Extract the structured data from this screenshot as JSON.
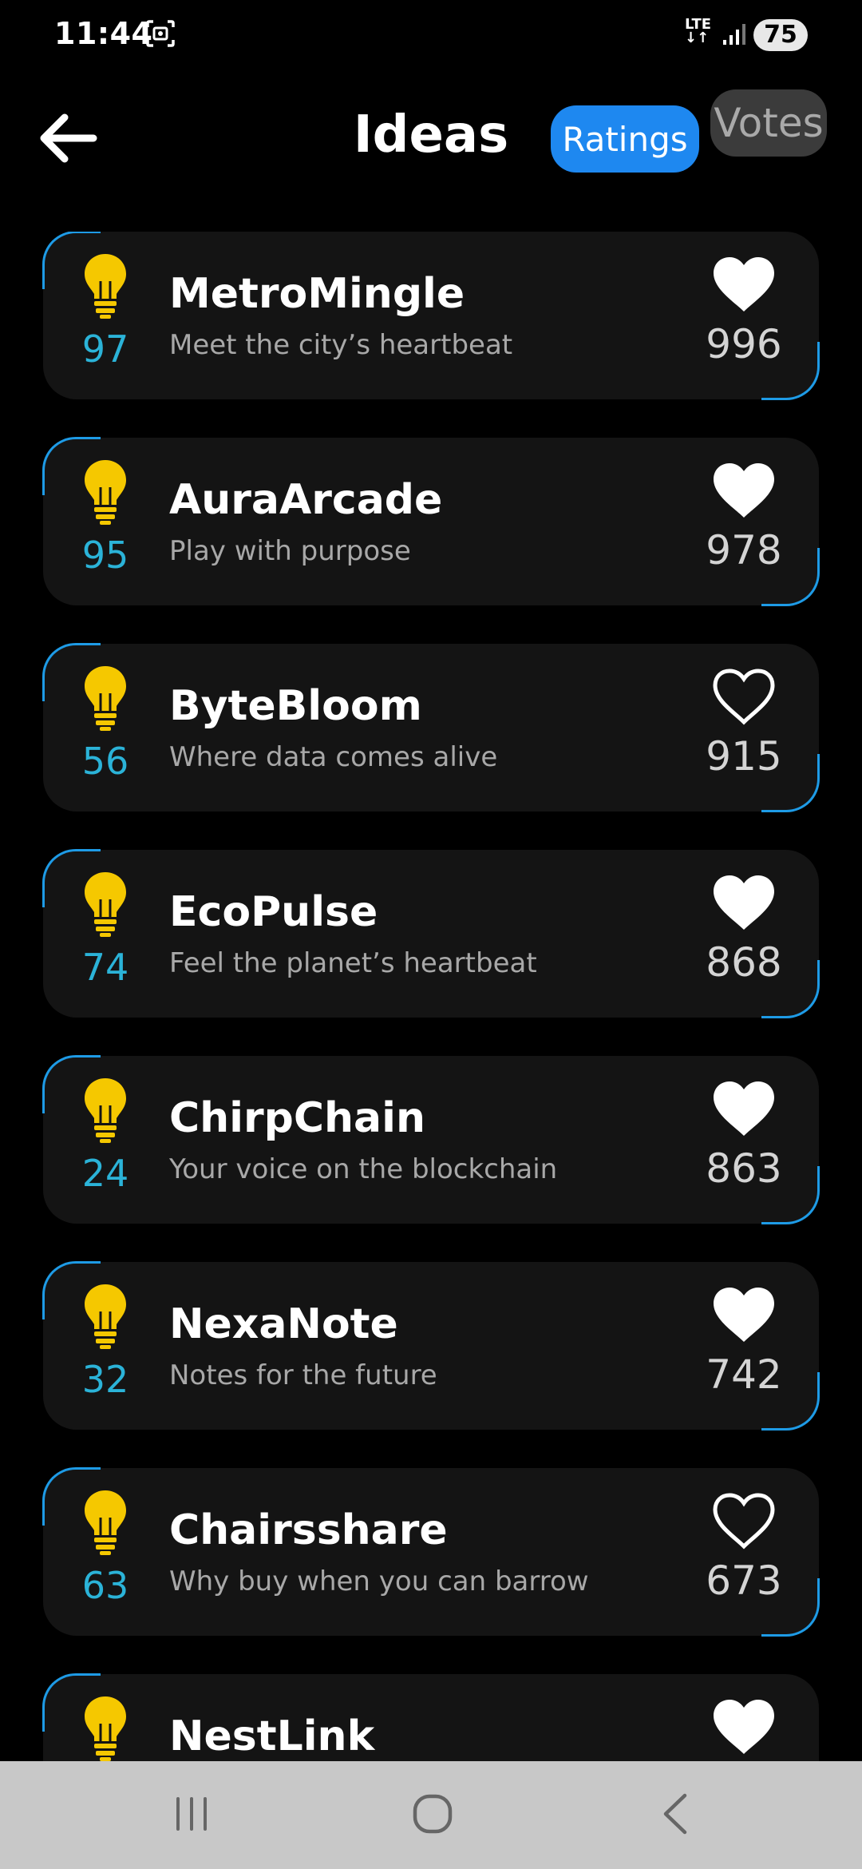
{
  "status_bar": {
    "time": "11:44",
    "network": "LTE",
    "battery": "75"
  },
  "header": {
    "title": "Ideas",
    "tabs": [
      {
        "label": "Ratings",
        "active": true
      },
      {
        "label": "Votes",
        "active": false
      }
    ]
  },
  "ideas": [
    {
      "name": "MetroMingle",
      "tagline": "Meet the city’s heartbeat",
      "rating": "97",
      "votes": "996",
      "liked": true
    },
    {
      "name": "AuraArcade",
      "tagline": "Play with purpose",
      "rating": "95",
      "votes": "978",
      "liked": true
    },
    {
      "name": "ByteBloom",
      "tagline": "Where data comes alive",
      "rating": "56",
      "votes": "915",
      "liked": false
    },
    {
      "name": "EcoPulse",
      "tagline": "Feel the planet’s heartbeat",
      "rating": "74",
      "votes": "868",
      "liked": true
    },
    {
      "name": "ChirpChain",
      "tagline": "Your voice on the blockchain",
      "rating": "24",
      "votes": "863",
      "liked": true
    },
    {
      "name": "NexaNote",
      "tagline": "Notes for the future",
      "rating": "32",
      "votes": "742",
      "liked": true
    },
    {
      "name": "Chairsshare",
      "tagline": "Why buy when you can barrow",
      "rating": "63",
      "votes": "673",
      "liked": false
    },
    {
      "name": "NestLink",
      "tagline": "",
      "rating": "",
      "votes": "",
      "liked": true
    }
  ],
  "icons": {
    "bulb_color": "#f5c800",
    "accent": "#1e88f0",
    "rating_color": "#2bb3d8"
  }
}
